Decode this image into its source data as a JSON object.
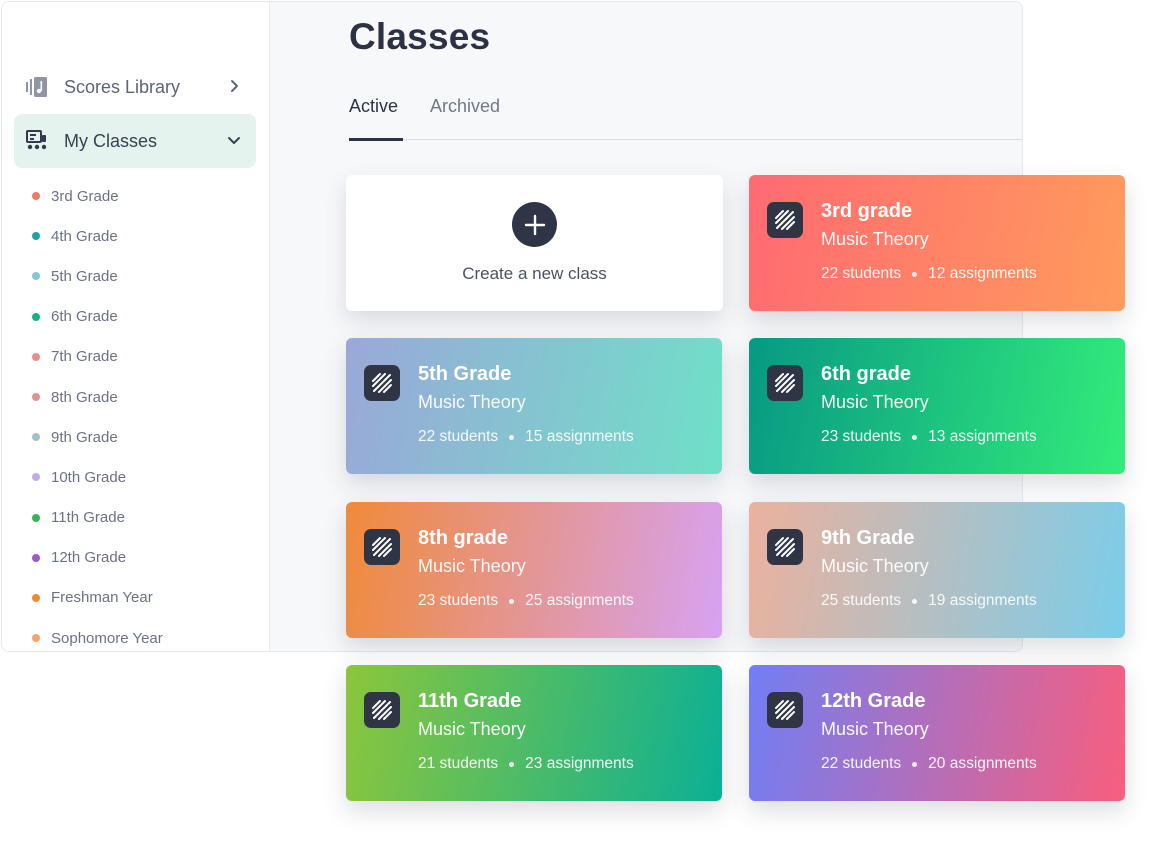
{
  "sidebar": {
    "scores_library": {
      "label": "Scores Library",
      "icon": "scores-library-icon",
      "chevron": "chevron-right-icon"
    },
    "my_classes": {
      "label": "My Classes",
      "icon": "my-classes-icon",
      "chevron": "chevron-down-icon"
    },
    "classes": [
      {
        "label": "3rd Grade",
        "color": "#f07a66"
      },
      {
        "label": "4th Grade",
        "color": "#1fa3a6"
      },
      {
        "label": "5th Grade",
        "color": "#84c7d9"
      },
      {
        "label": "6th Grade",
        "color": "#12b380"
      },
      {
        "label": "7th Grade",
        "color": "#e88c92"
      },
      {
        "label": "8th Grade",
        "color": "#e0958a"
      },
      {
        "label": "9th Grade",
        "color": "#9fc3c9"
      },
      {
        "label": "10th Grade",
        "color": "#c2a8f0"
      },
      {
        "label": "11th Grade",
        "color": "#3bb554"
      },
      {
        "label": "12th Grade",
        "color": "#a055c9"
      },
      {
        "label": "Freshman Year",
        "color": "#f08a2a"
      },
      {
        "label": "Sophomore Year",
        "color": "#f7a36a"
      }
    ]
  },
  "main": {
    "title": "Classes",
    "tabs": [
      {
        "label": "Active",
        "active": true
      },
      {
        "label": "Archived",
        "active": false
      }
    ],
    "create_card": {
      "label": "Create a new class",
      "icon": "plus-icon"
    },
    "cards": [
      {
        "title": "3rd grade",
        "subtitle": "Music Theory",
        "students": "22 students",
        "assignments": "12 assignments",
        "gradient": [
          "#ff6a72",
          "#ff9b5c"
        ]
      },
      {
        "title": "5th Grade",
        "subtitle": "Music Theory",
        "students": "22 students",
        "assignments": "15 assignments",
        "gradient": [
          "#9aa8d8",
          "#6fe0c8"
        ]
      },
      {
        "title": "6th grade",
        "subtitle": "Music Theory",
        "students": "23 students",
        "assignments": "13 assignments",
        "gradient": [
          "#079984",
          "#33ec7a"
        ]
      },
      {
        "title": "8th grade",
        "subtitle": "Music Theory",
        "students": "23 students",
        "assignments": "25 assignments",
        "gradient": [
          "#f08a3a",
          "#d7a2f2"
        ]
      },
      {
        "title": "9th Grade",
        "subtitle": "Music Theory",
        "students": "25 students",
        "assignments": "19 assignments",
        "gradient": [
          "#ecb19d",
          "#7bcde9"
        ]
      },
      {
        "title": "11th Grade",
        "subtitle": "Music Theory",
        "students": "21 students",
        "assignments": "23 assignments",
        "gradient": [
          "#8cc63c",
          "#0bb095"
        ]
      },
      {
        "title": "12th Grade",
        "subtitle": "Music Theory",
        "students": "22 students",
        "assignments": "20 assignments",
        "gradient": [
          "#717ef4",
          "#f85e7e"
        ]
      }
    ],
    "card_icon": "score-stripes-icon"
  }
}
